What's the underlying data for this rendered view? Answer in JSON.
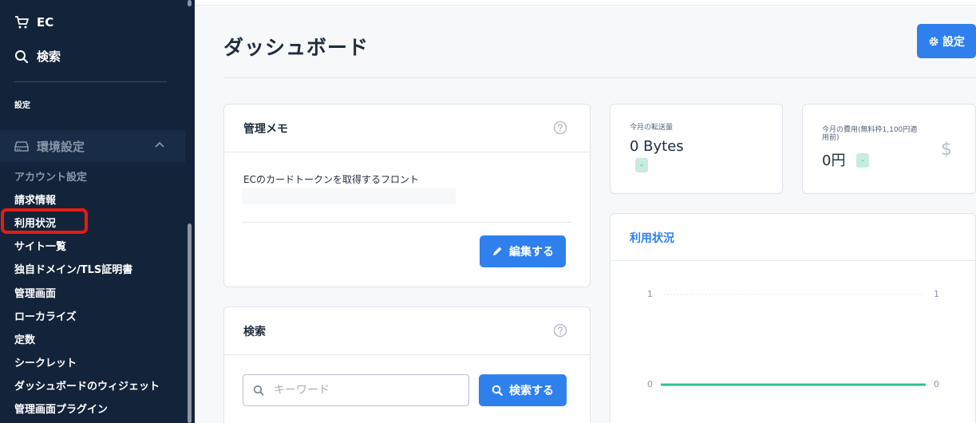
{
  "sidebar": {
    "top_items": [
      {
        "label": "EC",
        "icon": "cart-icon"
      },
      {
        "label": "検索",
        "icon": "search-icon"
      }
    ],
    "section_label": "設定",
    "group": {
      "label": "環境設定",
      "icon": "drive-icon",
      "expanded": true
    },
    "sub_items": [
      {
        "label": "アカウント設定",
        "muted": true
      },
      {
        "label": "請求情報"
      },
      {
        "label": "利用状況",
        "highlighted": true
      },
      {
        "label": "サイト一覧"
      },
      {
        "label": "独自ドメイン/TLS証明書"
      },
      {
        "label": "管理画面"
      },
      {
        "label": "ローカライズ"
      },
      {
        "label": "定数"
      },
      {
        "label": "シークレット"
      },
      {
        "label": "ダッシュボードのウィジェット"
      },
      {
        "label": "管理画面プラグイン"
      }
    ]
  },
  "header": {
    "title": "ダッシュボード",
    "settings_label": "設定"
  },
  "memo": {
    "title": "管理メモ",
    "text": "ECのカードトークンを取得するフロント",
    "edit_label": "編集する"
  },
  "search": {
    "title": "検索",
    "placeholder": "キーワード",
    "button_label": "検索する"
  },
  "stats": {
    "transfer": {
      "label": "今月の転送量",
      "value": "0 Bytes",
      "badge": "-"
    },
    "cost": {
      "label_line1": "今月の費用(無料枠1,100円適",
      "label_line2": "用前)",
      "value": "0円",
      "badge": "-",
      "symbol": "$"
    }
  },
  "usage": {
    "title": "利用状況",
    "line_color": "#2ec28f"
  },
  "chart_data": {
    "type": "line",
    "title": "利用状況",
    "y_ticks_left": [
      "1",
      "0"
    ],
    "y_ticks_right": [
      "1",
      "0"
    ],
    "ylim": [
      0,
      1
    ],
    "series": [
      {
        "values": [
          0,
          0
        ]
      }
    ]
  },
  "colors": {
    "accent": "#2f80ed",
    "sidebar": "#13233a",
    "highlight": "#e41c12"
  }
}
